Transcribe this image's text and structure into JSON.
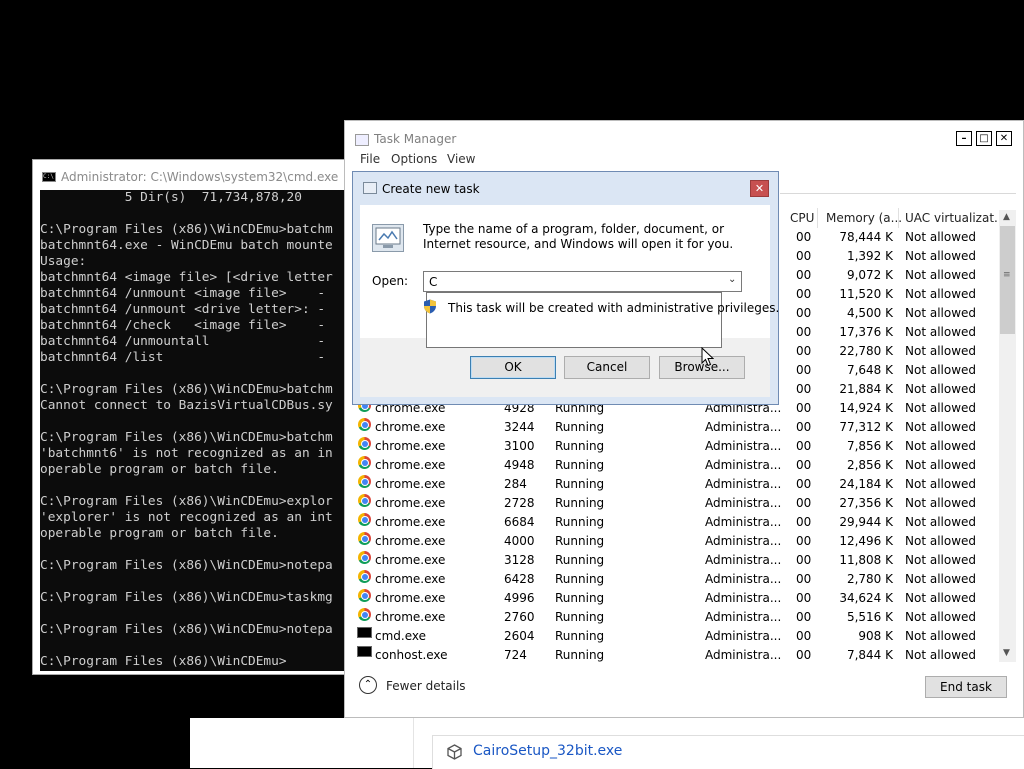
{
  "download": {
    "filename": "CairoSetup_32bit.exe"
  },
  "cmd": {
    "title": "Administrator: C:\\Windows\\system32\\cmd.exe",
    "lines": [
      "           5 Dir(s)  71,734,878,20",
      "",
      "C:\\Program Files (x86)\\WinCDEmu>batchm",
      "batchmnt64.exe - WinCDEmu batch mounte",
      "Usage:",
      "batchmnt64 <image file> [<drive letter",
      "batchmnt64 /unmount <image file>    -",
      "batchmnt64 /unmount <drive letter>: -",
      "batchmnt64 /check   <image file>    -",
      "batchmnt64 /unmountall              -",
      "batchmnt64 /list                    -",
      "",
      "C:\\Program Files (x86)\\WinCDEmu>batchm",
      "Cannot connect to BazisVirtualCDBus.sy",
      "",
      "C:\\Program Files (x86)\\WinCDEmu>batchm",
      "'batchmnt6' is not recognized as an in",
      "operable program or batch file.",
      "",
      "C:\\Program Files (x86)\\WinCDEmu>explor",
      "'explorer' is not recognized as an int",
      "operable program or batch file.",
      "",
      "C:\\Program Files (x86)\\WinCDEmu>notepa",
      "",
      "C:\\Program Files (x86)\\WinCDEmu>taskmg",
      "",
      "C:\\Program Files (x86)\\WinCDEmu>notepa",
      "",
      "C:\\Program Files (x86)\\WinCDEmu>"
    ]
  },
  "taskmgr": {
    "title": "Task Manager",
    "menu": {
      "file": "File",
      "options": "Options",
      "view": "View"
    },
    "columns": {
      "cpu": "CPU",
      "memory": "Memory (a...",
      "uac": "UAC virtualizat..."
    },
    "rows": [
      {
        "icon": "none",
        "name": "",
        "pid": "",
        "status": "",
        "user": "",
        "cpu": "00",
        "mem": "78,444 K",
        "uac": "Not allowed"
      },
      {
        "icon": "none",
        "name": "",
        "pid": "",
        "status": "",
        "user": "",
        "cpu": "00",
        "mem": "1,392 K",
        "uac": "Not allowed"
      },
      {
        "icon": "none",
        "name": "",
        "pid": "",
        "status": "",
        "user": "",
        "cpu": "00",
        "mem": "9,072 K",
        "uac": "Not allowed"
      },
      {
        "icon": "none",
        "name": "",
        "pid": "",
        "status": "",
        "user": "",
        "cpu": "00",
        "mem": "11,520 K",
        "uac": "Not allowed"
      },
      {
        "icon": "none",
        "name": "",
        "pid": "",
        "status": "",
        "user": "",
        "cpu": "00",
        "mem": "4,500 K",
        "uac": "Not allowed"
      },
      {
        "icon": "none",
        "name": "",
        "pid": "",
        "status": "",
        "user": "",
        "cpu": "00",
        "mem": "17,376 K",
        "uac": "Not allowed"
      },
      {
        "icon": "none",
        "name": "",
        "pid": "",
        "status": "",
        "user": "",
        "cpu": "00",
        "mem": "22,780 K",
        "uac": "Not allowed"
      },
      {
        "icon": "none",
        "name": "",
        "pid": "",
        "status": "",
        "user": "",
        "cpu": "00",
        "mem": "7,648 K",
        "uac": "Not allowed"
      },
      {
        "icon": "none",
        "name": "",
        "pid": "",
        "status": "",
        "user": "",
        "cpu": "00",
        "mem": "21,884 K",
        "uac": "Not allowed"
      },
      {
        "icon": "chrome",
        "name": "chrome.exe",
        "pid": "4928",
        "status": "Running",
        "user": "Administra...",
        "cpu": "00",
        "mem": "14,924 K",
        "uac": "Not allowed"
      },
      {
        "icon": "chrome",
        "name": "chrome.exe",
        "pid": "3244",
        "status": "Running",
        "user": "Administra...",
        "cpu": "00",
        "mem": "77,312 K",
        "uac": "Not allowed"
      },
      {
        "icon": "chrome",
        "name": "chrome.exe",
        "pid": "3100",
        "status": "Running",
        "user": "Administra...",
        "cpu": "00",
        "mem": "7,856 K",
        "uac": "Not allowed"
      },
      {
        "icon": "chrome",
        "name": "chrome.exe",
        "pid": "4948",
        "status": "Running",
        "user": "Administra...",
        "cpu": "00",
        "mem": "2,856 K",
        "uac": "Not allowed"
      },
      {
        "icon": "chrome",
        "name": "chrome.exe",
        "pid": "284",
        "status": "Running",
        "user": "Administra...",
        "cpu": "00",
        "mem": "24,184 K",
        "uac": "Not allowed"
      },
      {
        "icon": "chrome",
        "name": "chrome.exe",
        "pid": "2728",
        "status": "Running",
        "user": "Administra...",
        "cpu": "00",
        "mem": "27,356 K",
        "uac": "Not allowed"
      },
      {
        "icon": "chrome",
        "name": "chrome.exe",
        "pid": "6684",
        "status": "Running",
        "user": "Administra...",
        "cpu": "00",
        "mem": "29,944 K",
        "uac": "Not allowed"
      },
      {
        "icon": "chrome",
        "name": "chrome.exe",
        "pid": "4000",
        "status": "Running",
        "user": "Administra...",
        "cpu": "00",
        "mem": "12,496 K",
        "uac": "Not allowed"
      },
      {
        "icon": "chrome",
        "name": "chrome.exe",
        "pid": "3128",
        "status": "Running",
        "user": "Administra...",
        "cpu": "00",
        "mem": "11,808 K",
        "uac": "Not allowed"
      },
      {
        "icon": "chrome",
        "name": "chrome.exe",
        "pid": "6428",
        "status": "Running",
        "user": "Administra...",
        "cpu": "00",
        "mem": "2,780 K",
        "uac": "Not allowed"
      },
      {
        "icon": "chrome",
        "name": "chrome.exe",
        "pid": "4996",
        "status": "Running",
        "user": "Administra...",
        "cpu": "00",
        "mem": "34,624 K",
        "uac": "Not allowed"
      },
      {
        "icon": "chrome",
        "name": "chrome.exe",
        "pid": "2760",
        "status": "Running",
        "user": "Administra...",
        "cpu": "00",
        "mem": "5,516 K",
        "uac": "Not allowed"
      },
      {
        "icon": "cmd",
        "name": "cmd.exe",
        "pid": "2604",
        "status": "Running",
        "user": "Administra...",
        "cpu": "00",
        "mem": "908 K",
        "uac": "Not allowed"
      },
      {
        "icon": "cmd",
        "name": "conhost.exe",
        "pid": "724",
        "status": "Running",
        "user": "Administra...",
        "cpu": "00",
        "mem": "7,844 K",
        "uac": "Not allowed"
      }
    ],
    "fewer_details": "Fewer details",
    "end_task": "End task"
  },
  "run_dialog": {
    "title": "Create new task",
    "description": "Type the name of a program, folder, document, or Internet resource, and Windows will open it for you.",
    "open_label": "Open:",
    "open_value": "C",
    "tooltip": "This task will be created with administrative privileges.",
    "ok": "OK",
    "cancel": "Cancel",
    "browse": "Browse..."
  },
  "colors": {
    "link": "#1a57c4",
    "close_red": "#c75050",
    "dialog_frame": "#dbe6f4"
  }
}
